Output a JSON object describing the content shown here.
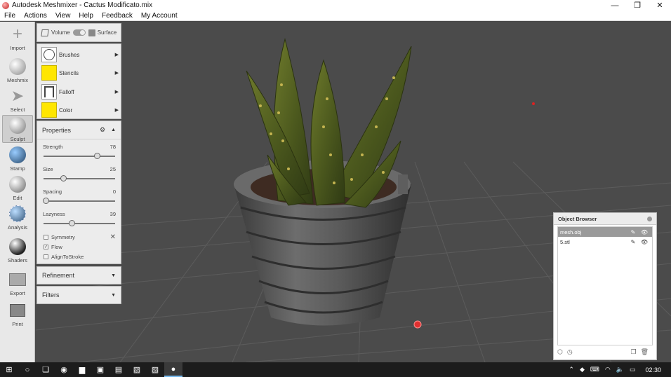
{
  "window": {
    "title": "Autodesk Meshmixer - Cactus Modificato.mix",
    "minimize": "—",
    "restore": "❐",
    "close": "✕"
  },
  "menu": [
    "File",
    "Actions",
    "View",
    "Help",
    "Feedback",
    "My Account"
  ],
  "toolbar": {
    "items": [
      {
        "label": "Import",
        "icon": "plus-icon"
      },
      {
        "label": "Meshmix",
        "icon": "meshmix-sphere-icon"
      },
      {
        "label": "Select",
        "icon": "select-arrow-icon"
      },
      {
        "label": "Sculpt",
        "icon": "sculpt-brush-icon",
        "active": true
      },
      {
        "label": "Stamp",
        "icon": "stamp-icon"
      },
      {
        "label": "Edit",
        "icon": "edit-sphere-icon"
      },
      {
        "label": "Analysis",
        "icon": "analysis-globe-icon"
      },
      {
        "label": "Shaders",
        "icon": "shader-sphere-icon"
      },
      {
        "label": "Export",
        "icon": "export-icon"
      },
      {
        "label": "Print",
        "icon": "print-icon"
      }
    ]
  },
  "mode": {
    "volume_label": "Volume",
    "surface_label": "Surface"
  },
  "tools": {
    "items": [
      {
        "label": "Brushes",
        "swatch": "brush"
      },
      {
        "label": "Stencils",
        "swatch": "yellow"
      },
      {
        "label": "Falloff",
        "swatch": "falloff"
      },
      {
        "label": "Color",
        "swatch": "yellow"
      }
    ],
    "arrow": "▶"
  },
  "properties": {
    "title": "Properties",
    "sliders": [
      {
        "label": "Strength",
        "value": "78",
        "fraction": 0.78
      },
      {
        "label": "Size",
        "value": "25",
        "fraction": 0.27
      },
      {
        "label": "Spacing",
        "value": "0",
        "fraction": 0.0
      },
      {
        "label": "Lazyness",
        "value": "39",
        "fraction": 0.39
      }
    ],
    "checkboxes": [
      {
        "label": "Symmetry",
        "checked": false
      },
      {
        "label": "Flow",
        "checked": true
      },
      {
        "label": "AlignToStroke",
        "checked": false
      }
    ]
  },
  "refinement": {
    "title": "Refinement"
  },
  "filters": {
    "title": "Filters"
  },
  "object_browser": {
    "title": "Object Browser",
    "items": [
      {
        "name": "mesh.obj",
        "selected": true
      },
      {
        "name": "5.stl",
        "selected": false
      }
    ]
  },
  "taskbar": {
    "clock": "02:30"
  },
  "colors": {
    "viewport": "#4b4b4b",
    "grid": "#5e5e5e",
    "pot": "#5a5a5a",
    "swatch_yellow": "#ffe600",
    "selection": "#9a9a9a"
  }
}
